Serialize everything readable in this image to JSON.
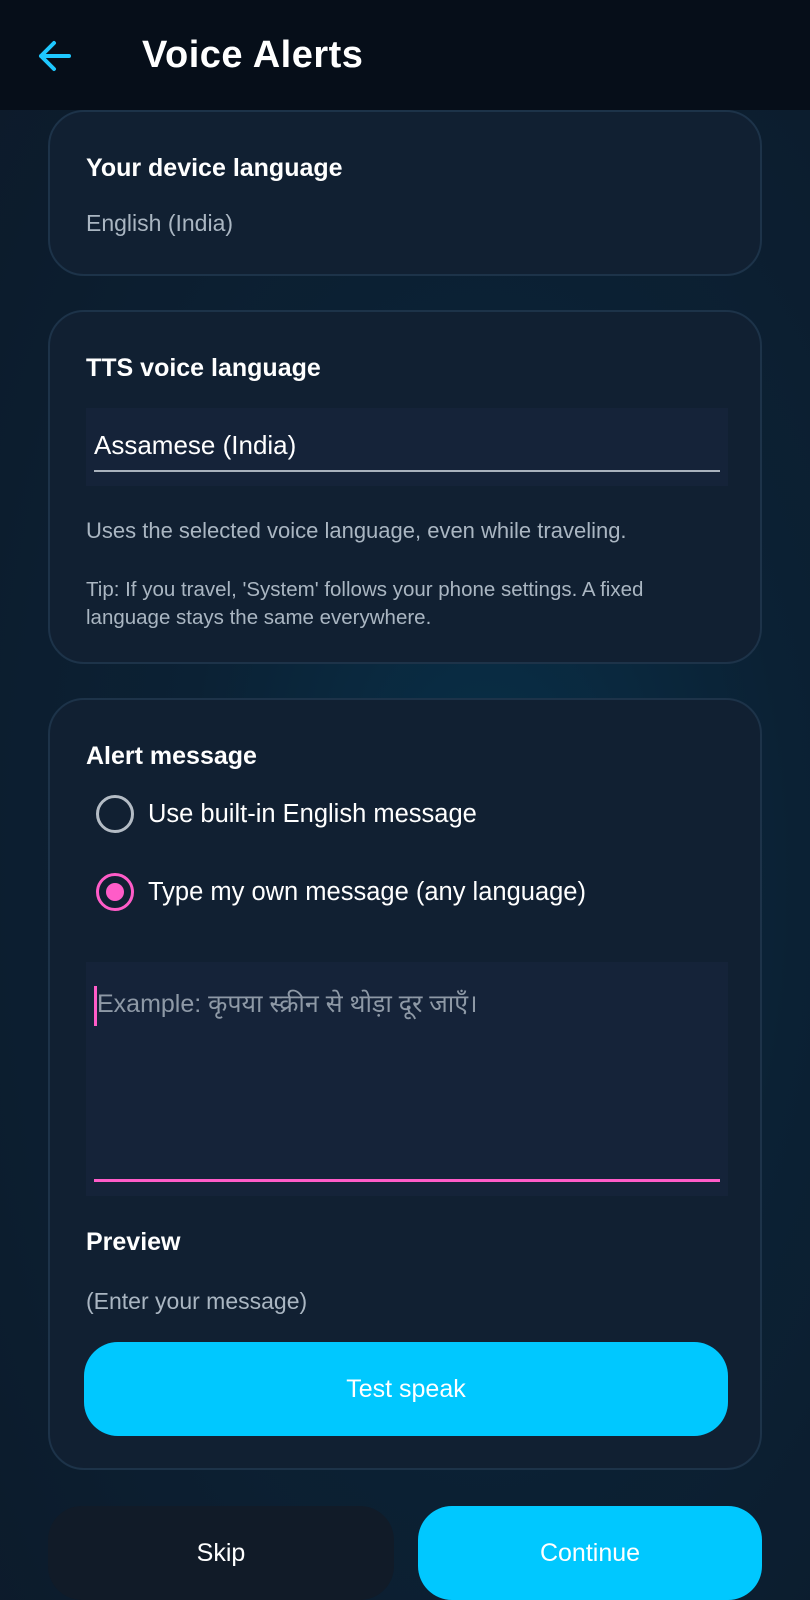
{
  "header": {
    "back_icon": "arrow-left-icon",
    "title": "Voice Alerts",
    "accent_color": "#1ec8ff"
  },
  "device_language": {
    "title": "Your device language",
    "value": "English (India)"
  },
  "tts_language": {
    "title": "TTS voice language",
    "selected": "Assamese (India)",
    "help": "Uses the selected voice language, even while traveling.",
    "tip": "Tip: If you travel, 'System' follows your phone settings. A fixed language stays the same everywhere."
  },
  "alert_message": {
    "title": "Alert message",
    "options": [
      {
        "label": "Use built-in English message",
        "selected": false
      },
      {
        "label": "Type my own message (any language)",
        "selected": true
      }
    ],
    "input_placeholder": "Example: कृपया स्क्रीन से थोड़ा दूर जाएँ।",
    "input_value": "",
    "preview_title": "Preview",
    "preview_text": "(Enter your message)",
    "test_button": "Test speak",
    "highlight_color": "#ff5cc8"
  },
  "footer": {
    "skip_label": "Skip",
    "continue_label": "Continue",
    "primary_color": "#00c8ff"
  }
}
